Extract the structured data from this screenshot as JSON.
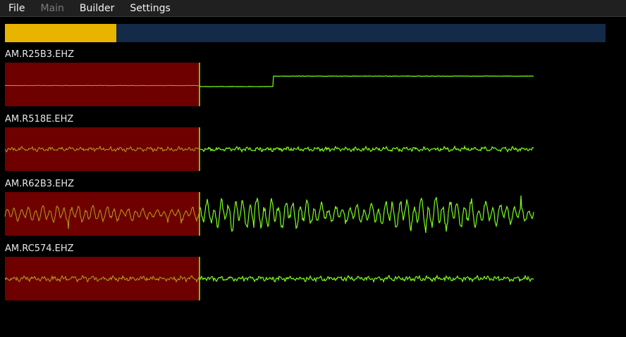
{
  "menu": {
    "items": [
      {
        "label": "File",
        "disabled": false
      },
      {
        "label": "Main",
        "disabled": true
      },
      {
        "label": "Builder",
        "disabled": false
      },
      {
        "label": "Settings",
        "disabled": false
      }
    ]
  },
  "progress": {
    "fraction": 0.185
  },
  "colors": {
    "progress_fill": "#e8b400",
    "progress_track": "#132a49",
    "history_bg": "#6e0000",
    "history_trace": "#b5a020",
    "live_trace": "#7cff1a",
    "cursor": "#7cff1a"
  },
  "channels": [
    {
      "name": "AM.R25B3.EHZ",
      "type": "step",
      "amplitude": 0.05
    },
    {
      "name": "AM.R518E.EHZ",
      "type": "noise",
      "amplitude": 0.12
    },
    {
      "name": "AM.R62B3.EHZ",
      "type": "burst",
      "amplitude": 0.7
    },
    {
      "name": "AM.RC574.EHZ",
      "type": "noise",
      "amplitude": 0.14
    }
  ]
}
